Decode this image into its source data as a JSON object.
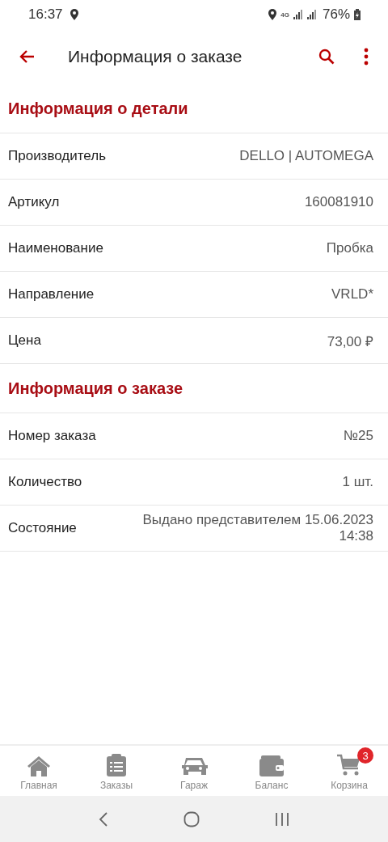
{
  "status_bar": {
    "time": "16:37",
    "network": "4G",
    "battery": "76%"
  },
  "app_bar": {
    "title": "Информация о заказе"
  },
  "sections": [
    {
      "title": "Информация о детали",
      "rows": [
        {
          "label": "Производитель",
          "value": "DELLO | AUTOMEGA"
        },
        {
          "label": "Артикул",
          "value": "160081910"
        },
        {
          "label": "Наименование",
          "value": "Пробка"
        },
        {
          "label": "Направление",
          "value": "VRLD*"
        },
        {
          "label": "Цена",
          "value": "73,00 ₽"
        }
      ]
    },
    {
      "title": "Информация о заказе",
      "rows": [
        {
          "label": "Номер заказа",
          "value": "№25"
        },
        {
          "label": "Количество",
          "value": "1 шт."
        },
        {
          "label": "Состояние",
          "value": "Выдано представителем 15.06.2023 14:38"
        }
      ]
    }
  ],
  "bottom_nav": [
    {
      "kind": "home",
      "label": "Главная"
    },
    {
      "kind": "orders",
      "label": "Заказы"
    },
    {
      "kind": "garage",
      "label": "Гараж"
    },
    {
      "kind": "balance",
      "label": "Баланс"
    },
    {
      "kind": "cart",
      "label": "Корзина",
      "badge": "3"
    }
  ]
}
